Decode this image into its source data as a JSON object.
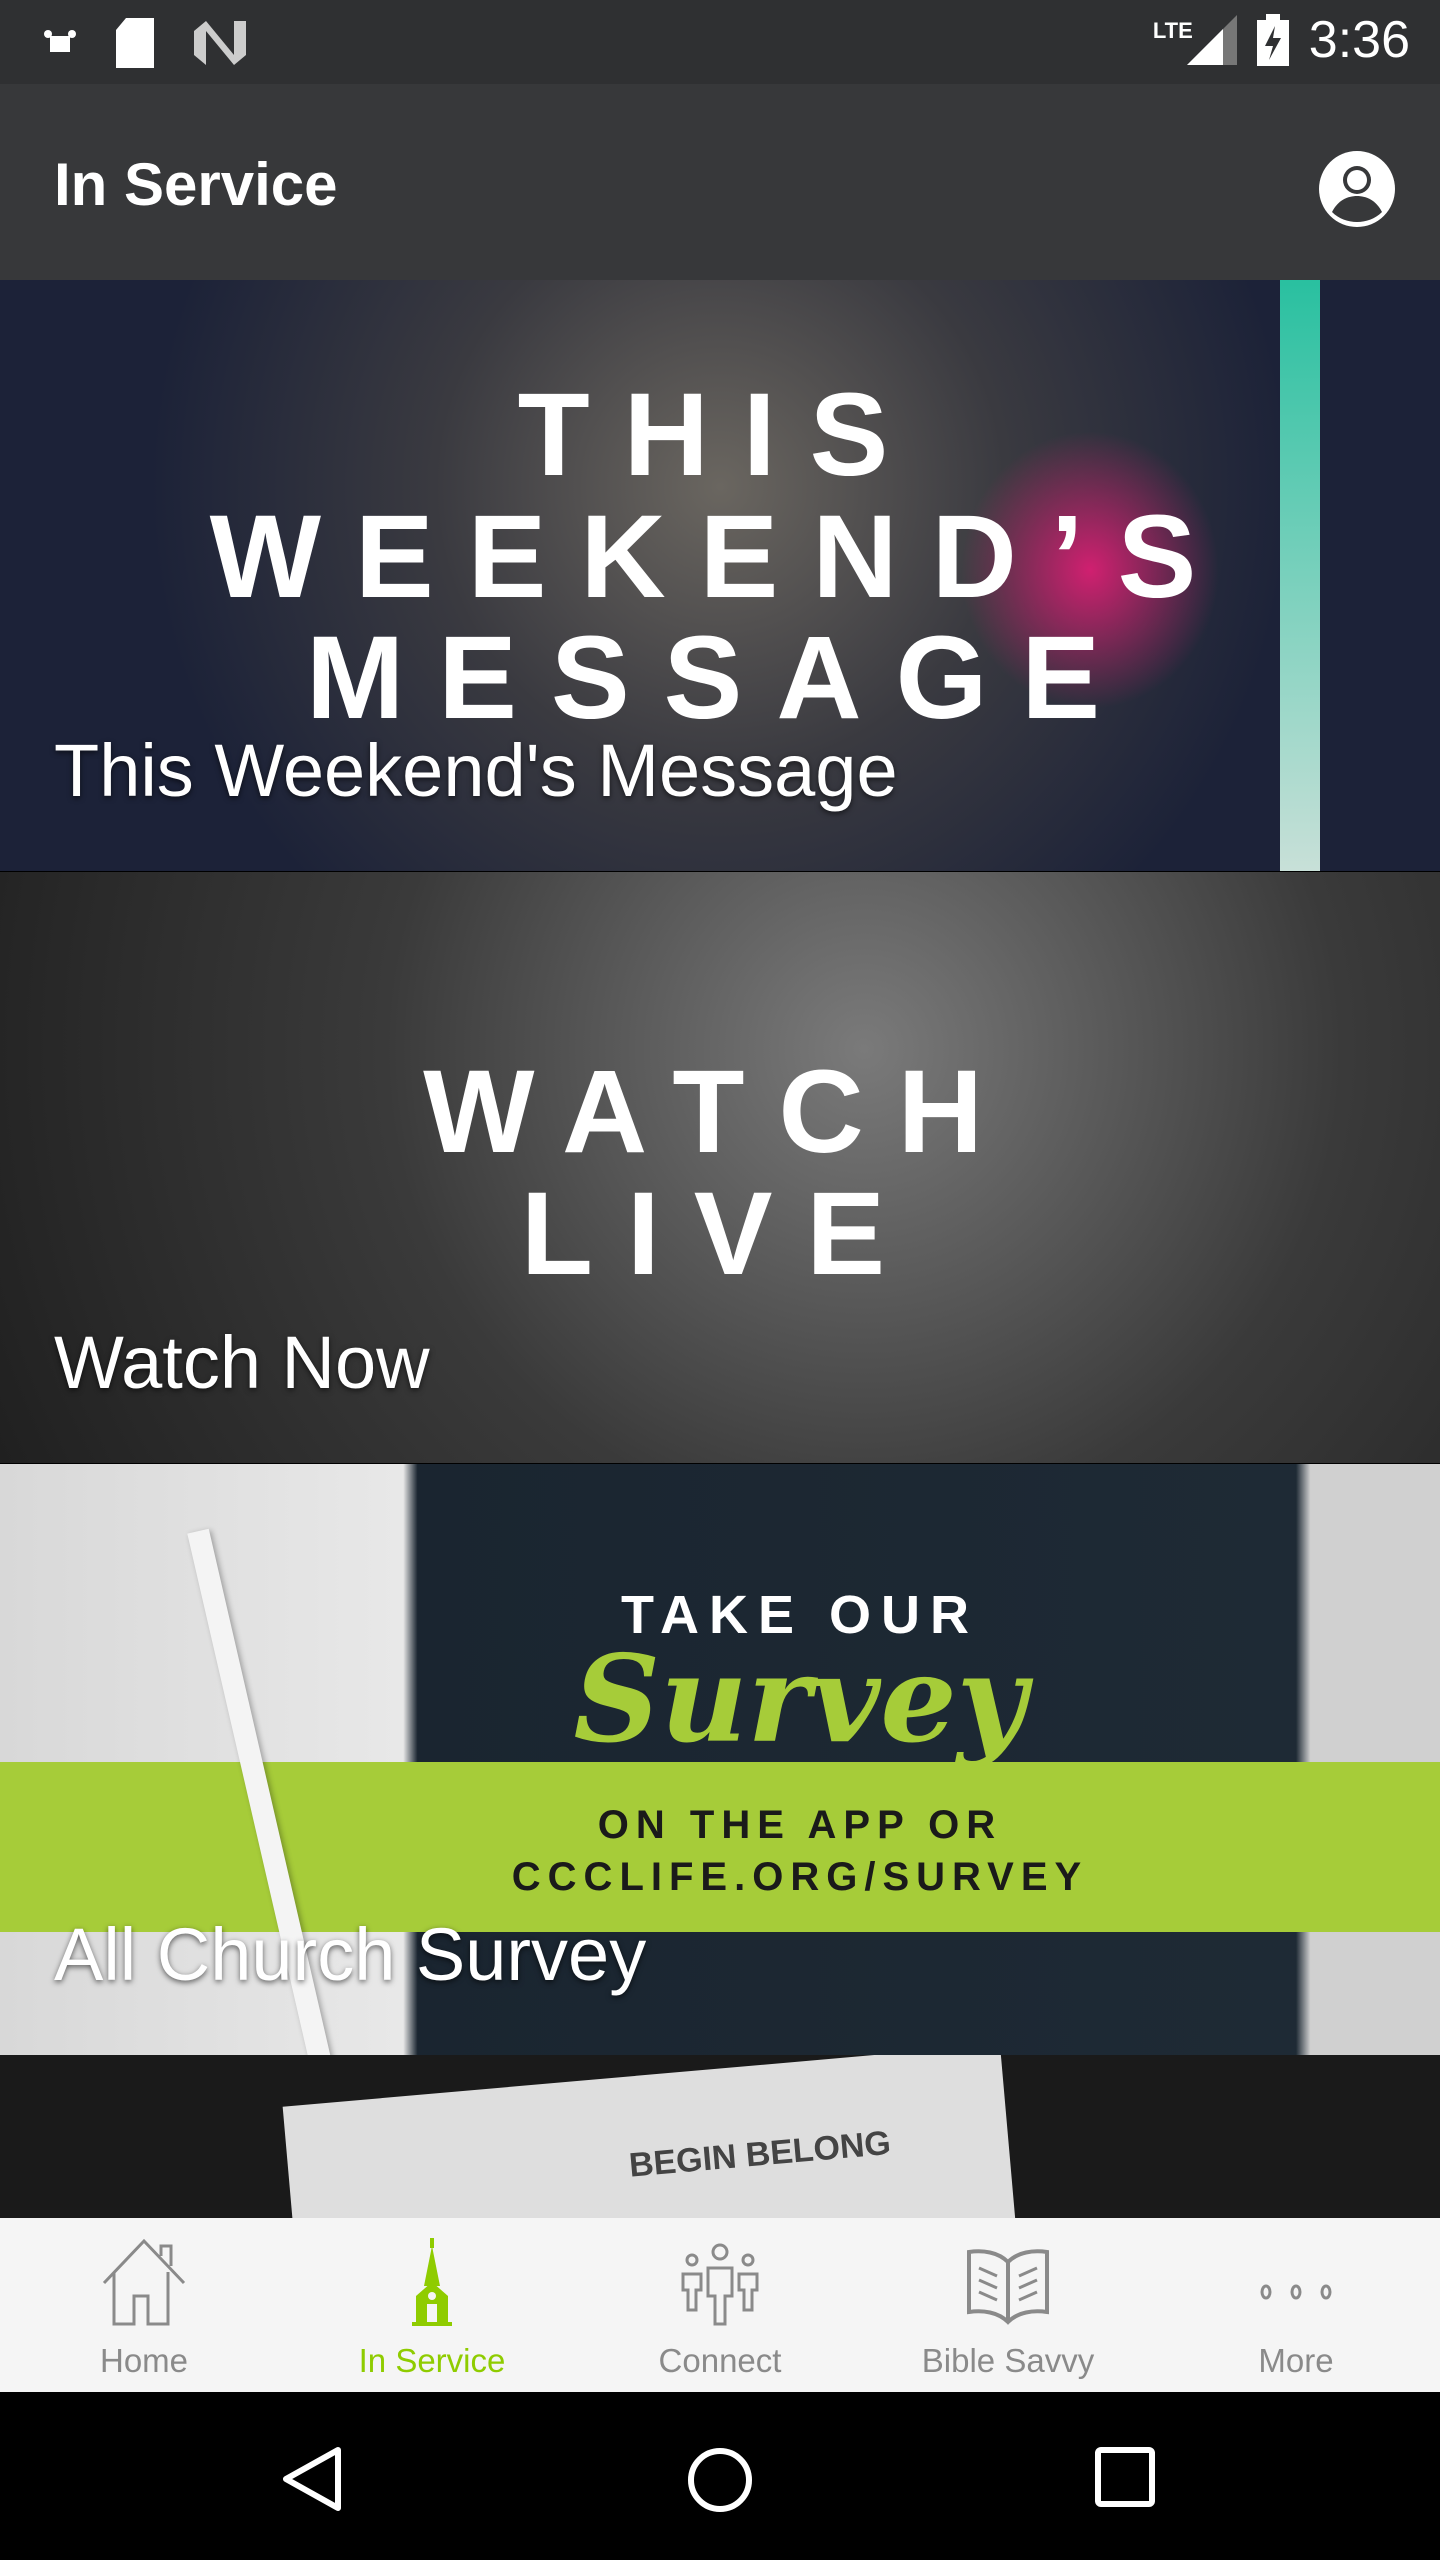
{
  "status_bar": {
    "time": "3:36",
    "network": "LTE",
    "icons": [
      "notification-icon",
      "sd-card-icon",
      "n-logo-icon",
      "signal-icon",
      "battery-charging-icon"
    ]
  },
  "app_bar": {
    "title": "In Service",
    "profile_icon": "account-circle-icon"
  },
  "cards": [
    {
      "label": "This Weekend's Message",
      "banner": [
        "THIS",
        "WEEKEND’S",
        "MESSAGE"
      ]
    },
    {
      "label": "Watch Now",
      "banner": [
        "WATCH",
        "LIVE"
      ]
    },
    {
      "label": "All Church Survey",
      "banner": [
        "TAKE OUR",
        "Survey",
        "ON THE APP OR",
        "CCCLIFE.ORG/SURVEY"
      ]
    },
    {
      "label": "",
      "banner": [
        "BEGIN BELONG"
      ]
    }
  ],
  "bottom_nav": {
    "accent": "#8fcc00",
    "items": [
      {
        "label": "Home",
        "icon": "home-icon"
      },
      {
        "label": "In Service",
        "icon": "church-icon",
        "active": true
      },
      {
        "label": "Connect",
        "icon": "people-icon"
      },
      {
        "label": "Bible Savvy",
        "icon": "book-icon"
      },
      {
        "label": "More",
        "icon": "more-icon"
      }
    ]
  }
}
